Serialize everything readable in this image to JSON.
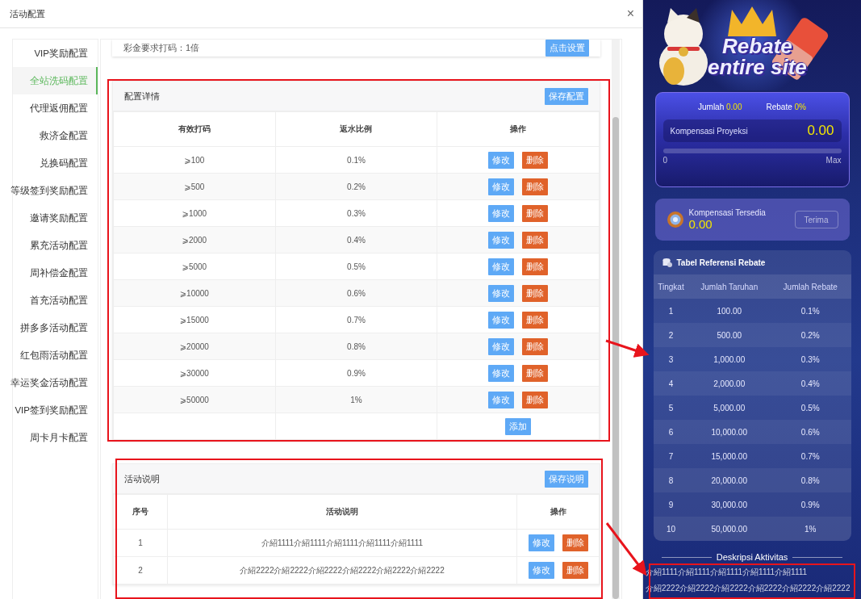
{
  "dialog": {
    "title": "活动配置",
    "close": "×"
  },
  "sidebar": {
    "items": [
      {
        "label": "VIP奖励配置",
        "selected": false
      },
      {
        "label": "全站洗码配置",
        "selected": true
      },
      {
        "label": "代理返佣配置",
        "selected": false
      },
      {
        "label": "救济金配置",
        "selected": false
      },
      {
        "label": "兑换码配置",
        "selected": false
      },
      {
        "label": "等级签到奖励配置",
        "selected": false
      },
      {
        "label": "邀请奖励配置",
        "selected": false
      },
      {
        "label": "累充活动配置",
        "selected": false
      },
      {
        "label": "周补偿金配置",
        "selected": false
      },
      {
        "label": "首充活动配置",
        "selected": false
      },
      {
        "label": "拼多多活动配置",
        "selected": false
      },
      {
        "label": "红包雨活动配置",
        "selected": false
      },
      {
        "label": "幸运奖金活动配置",
        "selected": false
      },
      {
        "label": "VIP签到奖励配置",
        "selected": false
      },
      {
        "label": "周卡月卡配置",
        "selected": false
      }
    ]
  },
  "top_card": {
    "text": "彩金要求打码：1倍",
    "button": "点击设置"
  },
  "config_panel": {
    "title": "配置详情",
    "save_button": "保存配置",
    "columns": [
      "有效打码",
      "返水比例",
      "操作"
    ],
    "rows": [
      {
        "threshold": "⩾100",
        "ratio": "0.1%",
        "edit": "修改",
        "delete": "删除"
      },
      {
        "threshold": "⩾500",
        "ratio": "0.2%",
        "edit": "修改",
        "delete": "删除"
      },
      {
        "threshold": "⩾1000",
        "ratio": "0.3%",
        "edit": "修改",
        "delete": "删除"
      },
      {
        "threshold": "⩾2000",
        "ratio": "0.4%",
        "edit": "修改",
        "delete": "删除"
      },
      {
        "threshold": "⩾5000",
        "ratio": "0.5%",
        "edit": "修改",
        "delete": "删除"
      },
      {
        "threshold": "⩾10000",
        "ratio": "0.6%",
        "edit": "修改",
        "delete": "删除"
      },
      {
        "threshold": "⩾15000",
        "ratio": "0.7%",
        "edit": "修改",
        "delete": "删除"
      },
      {
        "threshold": "⩾20000",
        "ratio": "0.8%",
        "edit": "修改",
        "delete": "删除"
      },
      {
        "threshold": "⩾30000",
        "ratio": "0.9%",
        "edit": "修改",
        "delete": "删除"
      },
      {
        "threshold": "⩾50000",
        "ratio": "1%",
        "edit": "修改",
        "delete": "删除"
      }
    ],
    "add_button": "添加"
  },
  "description_panel": {
    "title": "活动说明",
    "save_button": "保存说明",
    "columns": [
      "序号",
      "活动说明",
      "操作"
    ],
    "rows": [
      {
        "index": "1",
        "text": "介紹1111介紹1111介紹1111介紹1111介紹1111",
        "edit": "修改",
        "delete": "删除"
      },
      {
        "index": "2",
        "text": "介紹2222介紹2222介紹2222介紹2222介紹2222介紹2222",
        "edit": "修改",
        "delete": "删除"
      }
    ]
  },
  "preview": {
    "banner_title": [
      "Rebate",
      "entire site"
    ],
    "summary": {
      "jumlah_label": "Jumlah",
      "jumlah_value": "0.00",
      "rebate_label": "Rebate",
      "rebate_value": "0%"
    },
    "projection": {
      "label": "Kompensasi Proyeksi",
      "value": "0.00",
      "level": 0,
      "min_label": "0",
      "max_label": "Max"
    },
    "available": {
      "label": "Kompensasi Tersedia",
      "value": "0.00",
      "button": "Terima",
      "disabled": true
    },
    "table": {
      "title": "Tabel Referensi Rebate",
      "columns": [
        "Tingkat",
        "Jumlah Taruhan",
        "Jumlah Rebate"
      ],
      "rows": [
        [
          "1",
          "100.00",
          "0.1%"
        ],
        [
          "2",
          "500.00",
          "0.2%"
        ],
        [
          "3",
          "1,000.00",
          "0.3%"
        ],
        [
          "4",
          "2,000.00",
          "0.4%"
        ],
        [
          "5",
          "5,000.00",
          "0.5%"
        ],
        [
          "6",
          "10,000.00",
          "0.6%"
        ],
        [
          "7",
          "15,000.00",
          "0.7%"
        ],
        [
          "8",
          "20,000.00",
          "0.8%"
        ],
        [
          "9",
          "30,000.00",
          "0.9%"
        ],
        [
          "10",
          "50,000.00",
          "1%"
        ]
      ]
    },
    "description": {
      "title": "Deskripsi Aktivitas",
      "lines": [
        "介紹1111介紹1111介紹1111介紹1111介紹1111",
        "介紹2222介紹2222介紹2222介紹2222介紹2222介紹2222"
      ]
    }
  }
}
